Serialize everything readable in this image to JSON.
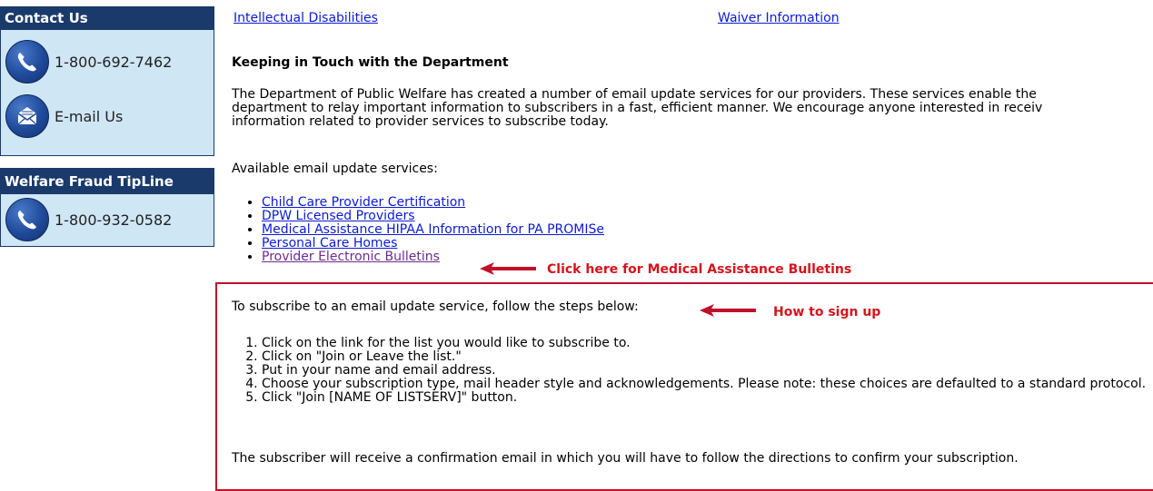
{
  "sidebar": {
    "contact": {
      "title": "Contact Us",
      "phone": "1-800-692-7462",
      "email_label": "E-mail Us"
    },
    "tipline": {
      "title": "Welfare Fraud TipLine",
      "phone": "1-800-932-0582"
    }
  },
  "top_links": [
    "Intellectual Disabilities",
    "Waiver Information"
  ],
  "main": {
    "heading": "Keeping in Touch with the Department",
    "intro_lines": [
      "The Department of Public Welfare has created a number of email update services for our providers. These services enable the",
      "department to relay important information to subscribers in a fast, efficient manner. We encourage anyone interested in receiv",
      "information related to provider services to subscribe today."
    ],
    "available_label": "Available email update services:",
    "services": [
      "Child Care Provider Certification",
      "DPW Licensed Providers",
      "Medical Assistance HIPAA Information for PA PROMISe",
      "Personal Care Homes",
      "Provider Electronic Bulletins"
    ],
    "bulletin_callout": "Click here for Medical Assistance Bulletins",
    "instructions": "To subscribe to an email update service, follow the steps below:",
    "signup_callout": "How to sign up",
    "steps": [
      "Click on the link for the list you would like to subscribe to.",
      "Click on \"Join or Leave the list.\"",
      "Put in your name and email address.",
      "Choose your subscription type, mail header style and acknowledgements. Please note: these choices are defaulted to a standard protocol.",
      "Click \"Join [NAME OF LISTSERV]\" button."
    ],
    "confirmation": "The subscriber will receive a confirmation email in which you will have to follow the directions to confirm your subscription."
  },
  "colors": {
    "sidebar_header": "#1a3a6b",
    "sidebar_bg": "#cfe6f5",
    "link": "#0a1ad6",
    "visited_link": "#6e2a90",
    "callout_red": "#d4141d"
  },
  "icons": [
    "phone-icon",
    "email-icon",
    "phone-icon",
    "arrow-left-icon"
  ]
}
